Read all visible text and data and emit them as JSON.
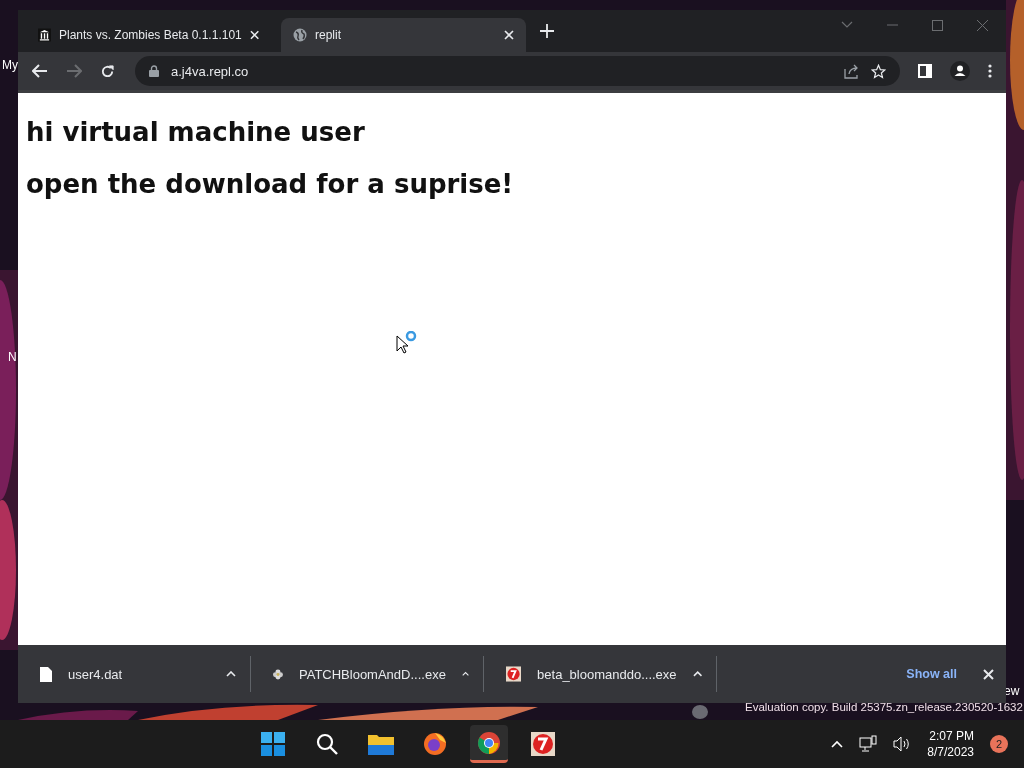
{
  "desktop": {
    "icon_labels": [
      {
        "text": "My"
      },
      {
        "text": "N"
      },
      {
        "text": "ew"
      }
    ],
    "watermark": "Evaluation copy. Build 25375.zn_release.230520-1632"
  },
  "browser": {
    "tabs": [
      {
        "title": "Plants vs. Zombies Beta 0.1.1.101",
        "kind": "museum",
        "selected": false
      },
      {
        "title": "replit",
        "kind": "globe",
        "selected": true
      }
    ],
    "address": "a.j4va.repl.co",
    "page": {
      "lines": [
        "hi virtual machine user",
        "open the download for a suprise!"
      ],
      "loading": true
    },
    "downloads": [
      {
        "name": "user4.dat",
        "kind": "file"
      },
      {
        "name": "PATCHBloomAndD....exe",
        "kind": "flower"
      },
      {
        "name": "beta_bloomanddo....exe",
        "kind": "app"
      }
    ],
    "show_all": "Show all"
  },
  "taskbar": {
    "apps": [
      {
        "kind": "start",
        "selected": false
      },
      {
        "kind": "search",
        "selected": false
      },
      {
        "kind": "folder",
        "selected": false
      },
      {
        "kind": "firefox",
        "selected": false
      },
      {
        "kind": "chrome",
        "selected": true
      },
      {
        "kind": "app",
        "selected": false
      }
    ],
    "time": "2:07 PM",
    "date": "8/7/2023",
    "notifications": "2"
  }
}
